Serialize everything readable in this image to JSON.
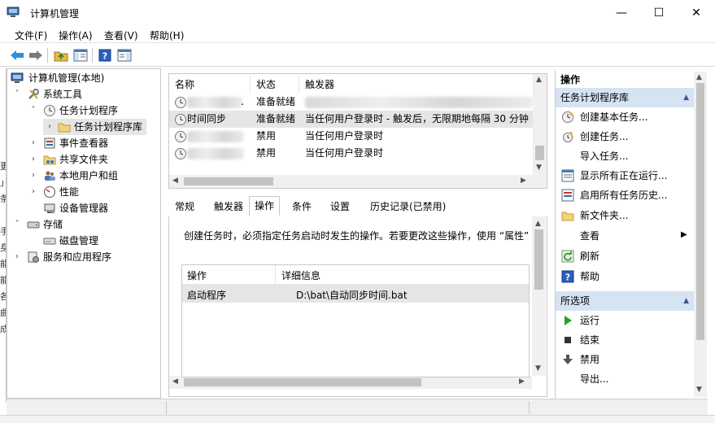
{
  "window": {
    "title": "计算机管理",
    "minimize": "—",
    "maximize": "☐",
    "close": "✕"
  },
  "menu": [
    "文件(F)",
    "操作(A)",
    "查看(V)",
    "帮助(H)"
  ],
  "tree": {
    "root": "计算机管理(本地)",
    "system_tools": "系统工具",
    "task_scheduler": "任务计划程序",
    "task_library": "任务计划程序库",
    "event_viewer": "事件查看器",
    "shared_folders": "共享文件夹",
    "local_users": "本地用户和组",
    "performance": "性能",
    "device_manager": "设备管理器",
    "storage": "存储",
    "disk_management": "磁盘管理",
    "services_apps": "服务和应用程序"
  },
  "left_edge_chars": [
    "更",
    "」",
    "条",
    "手",
    "身",
    "能",
    "能",
    "各",
    "曲",
    "成"
  ],
  "list": {
    "columns": [
      "名称",
      "状态",
      "触发器"
    ],
    "rows": [
      {
        "name": ".",
        "status": "准备就绪",
        "trigger": ""
      },
      {
        "name": "时间同步",
        "status": "准备就绪",
        "trigger": "当任何用户登录时 - 触发后，无限期地每隔 30 分钟 :"
      },
      {
        "name": "",
        "status": "禁用",
        "trigger": "当任何用户登录时"
      },
      {
        "name": "",
        "status": "禁用",
        "trigger": "当任何用户登录时"
      }
    ]
  },
  "tabs": [
    "常规",
    "触发器",
    "操作",
    "条件",
    "设置",
    "历史记录(已禁用)"
  ],
  "detail": {
    "description": "创建任务时，必须指定任务启动时发生的操作。若要更改这些操作，使用 “属性”",
    "columns": [
      "操作",
      "详细信息"
    ],
    "rows": [
      {
        "action": "启动程序",
        "detail": "D:\\bat\\自动同步时间.bat"
      }
    ]
  },
  "actions_pane": {
    "header": "操作",
    "section1": "任务计划程序库",
    "items1": [
      "创建基本任务...",
      "创建任务...",
      "导入任务...",
      "显示所有正在运行...",
      "启用所有任务历史...",
      "新文件夹...",
      "查看",
      "刷新",
      "帮助"
    ],
    "section2": "所选项",
    "items2": [
      "运行",
      "结束",
      "禁用",
      "导出..."
    ],
    "collapse_arrow": "▲",
    "submenu_arrow": "▶"
  },
  "icons": [
    "back-arrow-icon",
    "forward-arrow-icon",
    "up-folder-icon",
    "show-hide-tree-icon",
    "help-icon",
    "properties-icon"
  ]
}
